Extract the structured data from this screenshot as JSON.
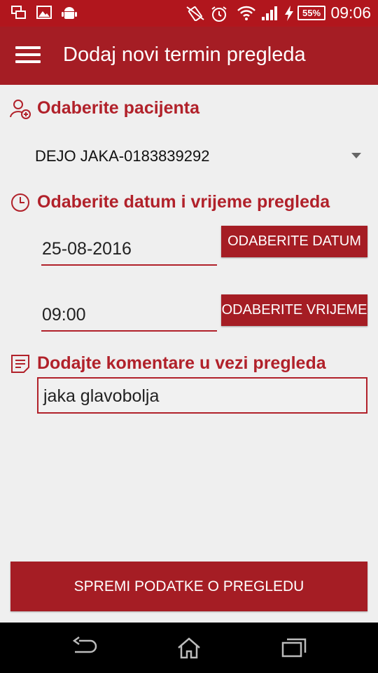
{
  "status_bar": {
    "battery": "55%",
    "time": "09:06",
    "icons": [
      "multi-window-icon",
      "gallery-icon",
      "android-icon",
      "vibrate-icon",
      "alarm-icon",
      "wifi-icon",
      "signal-icon",
      "charging-icon"
    ]
  },
  "app_bar": {
    "title": "Dodaj novi termin pregleda",
    "menu_icon": "hamburger-icon"
  },
  "patient_section": {
    "title": "Odaberite pacijenta",
    "icon": "add-user-icon",
    "selected_patient": "DEJO JAKA-0183839292"
  },
  "datetime_section": {
    "title": "Odaberite datum i vrijeme pregleda",
    "icon": "clock-icon",
    "date_value": "25-08-2016",
    "date_button": "ODABERITE DATUM",
    "time_value": "09:00",
    "time_button": "ODABERITE VRIJEME"
  },
  "comment_section": {
    "title": "Dodajte komentare u vezi pregleda",
    "icon": "note-icon",
    "comment_value": "jaka glavobolja"
  },
  "save_button": "SPREMI PODATKE O PREGLEDU",
  "nav_bar": {
    "icons": [
      "back-icon",
      "home-icon",
      "recents-icon"
    ]
  },
  "colors": {
    "primary": "#a51d24",
    "status_bar": "#b1161d",
    "accent_text": "#b1212a",
    "background": "#efefef"
  }
}
